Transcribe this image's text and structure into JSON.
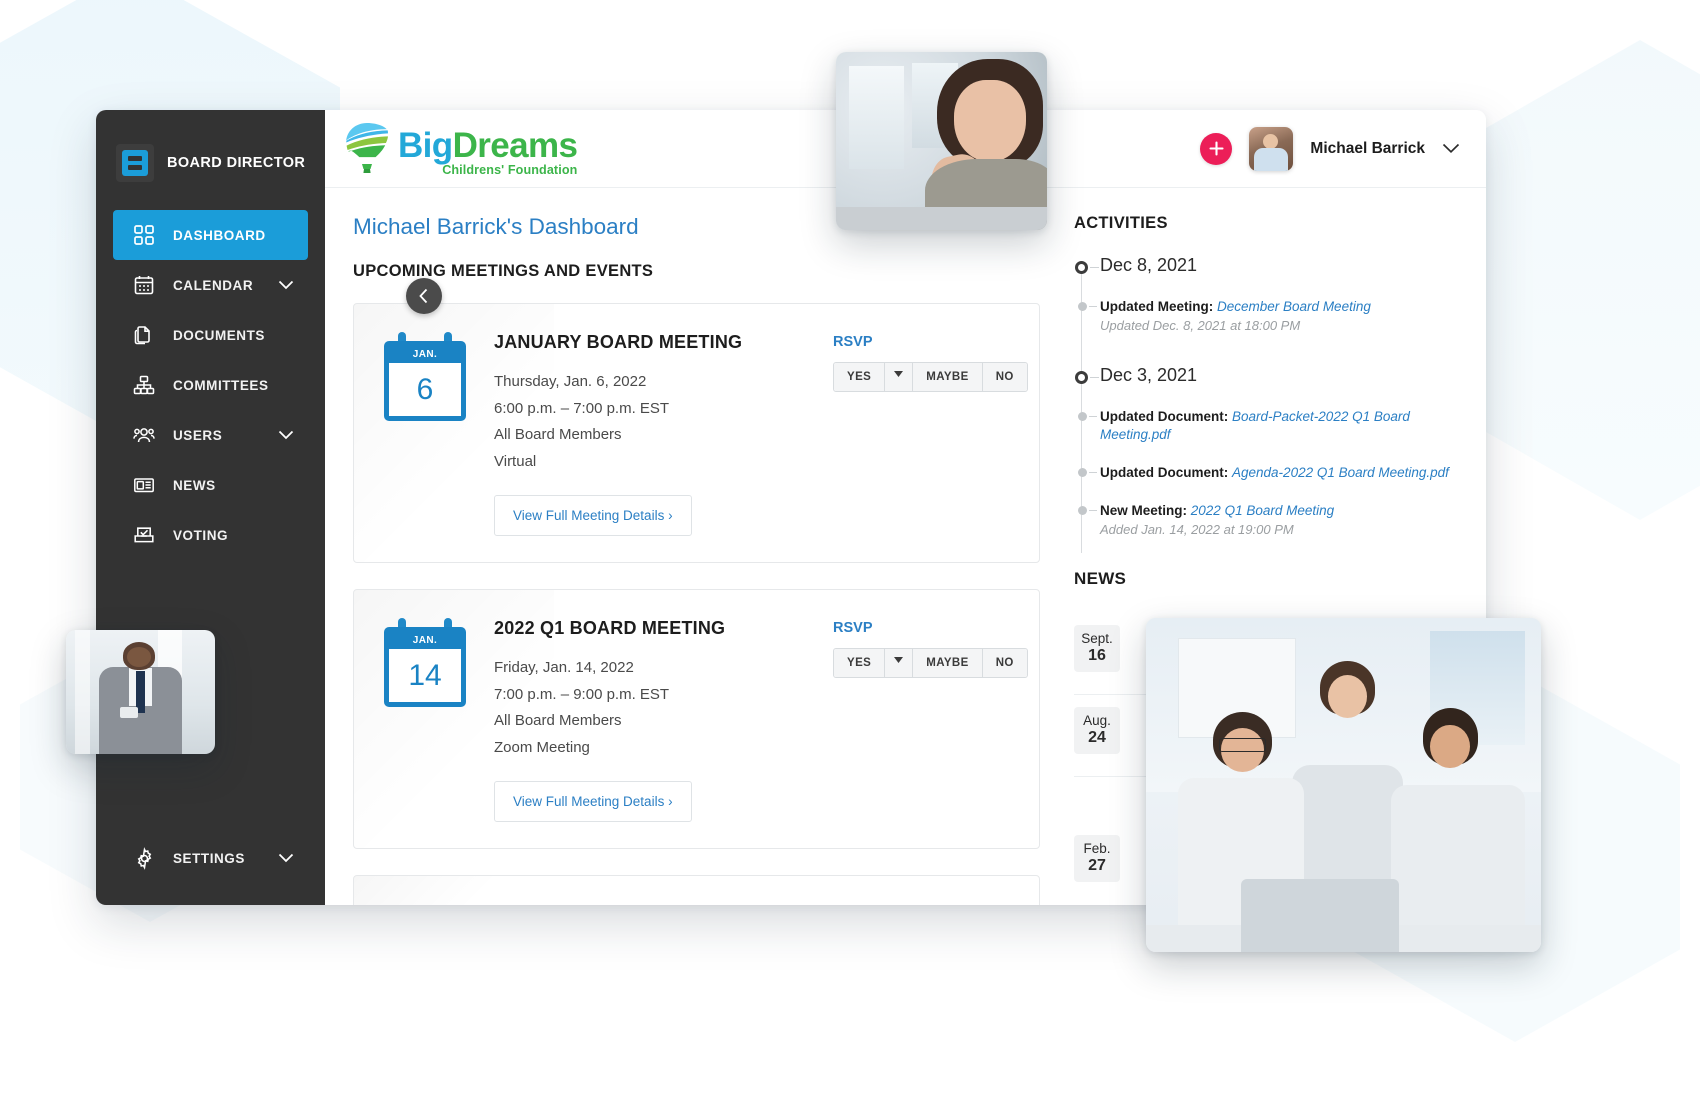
{
  "sidebar": {
    "brand": "BOARD DIRECTOR",
    "brand_icon": "board-director-logo-icon",
    "items": [
      {
        "label": "DASHBOARD",
        "icon": "grid-icon",
        "active": true,
        "chevron": false
      },
      {
        "label": "CALENDAR",
        "icon": "calendar-icon",
        "active": false,
        "chevron": true
      },
      {
        "label": "DOCUMENTS",
        "icon": "documents-icon",
        "active": false,
        "chevron": false
      },
      {
        "label": "COMMITTEES",
        "icon": "org-chart-icon",
        "active": false,
        "chevron": false
      },
      {
        "label": "USERS",
        "icon": "users-icon",
        "active": false,
        "chevron": true
      },
      {
        "label": "NEWS",
        "icon": "newspaper-icon",
        "active": false,
        "chevron": false
      },
      {
        "label": "VOTING",
        "icon": "ballot-box-icon",
        "active": false,
        "chevron": false
      }
    ],
    "settings": {
      "label": "SETTINGS",
      "icon": "gear-icon",
      "chevron": true
    },
    "collapse_icon": "chevron-left-icon"
  },
  "topbar": {
    "logo": {
      "word1": "Big",
      "word2": "Dreams",
      "tagline": "Childrens' Foundation",
      "icon": "hot-air-balloon-icon"
    },
    "add_button_label": "+",
    "user_name": "Michael Barrick",
    "user_caret_icon": "chevron-down-icon"
  },
  "page": {
    "title": "Michael Barrick's Dashboard",
    "meetings_section_title": "UPCOMING MEETINGS AND EVENTS"
  },
  "meetings": [
    {
      "month": "JAN.",
      "day": "6",
      "title": "JANUARY BOARD MEETING",
      "date": "Thursday, Jan. 6, 2022",
      "time": "6:00 p.m. – 7:00 p.m. EST",
      "audience": "All Board Members",
      "location": "Virtual",
      "details_label": "View Full Meeting Details ›",
      "rsvp_label": "RSVP",
      "rsvp_options": [
        "YES",
        "MAYBE",
        "NO"
      ],
      "rsvp_caret_icon": "caret-down-icon"
    },
    {
      "month": "JAN.",
      "day": "14",
      "title": "2022 Q1 BOARD MEETING",
      "date": "Friday, Jan. 14, 2022",
      "time": "7:00 p.m. – 9:00 p.m. EST",
      "audience": "All Board Members",
      "location": "Zoom Meeting",
      "details_label": "View Full Meeting Details ›",
      "rsvp_label": "RSVP",
      "rsvp_options": [
        "YES",
        "MAYBE",
        "NO"
      ],
      "rsvp_caret_icon": "caret-down-icon"
    }
  ],
  "activities": {
    "title": "ACTIVITIES",
    "groups": [
      {
        "date": "Dec 8, 2021",
        "items": [
          {
            "kind": "Updated Meeting:",
            "target": "December Board Meeting",
            "sub": "Updated Dec. 8, 2021 at 18:00 PM"
          }
        ]
      },
      {
        "date": "Dec 3, 2021",
        "items": [
          {
            "kind": "Updated Document:",
            "target": "Board-Packet-2022 Q1 Board Meeting.pdf",
            "sub": ""
          },
          {
            "kind": "Updated Document:",
            "target": "Agenda-2022 Q1 Board Meeting.pdf",
            "sub": ""
          },
          {
            "kind": "New Meeting:",
            "target": "2022 Q1 Board Meeting",
            "sub": "Added Jan. 14, 2022 at 19:00 PM"
          }
        ]
      }
    ]
  },
  "news": {
    "title": "NEWS",
    "items": [
      {
        "month": "Sept.",
        "day": "16"
      },
      {
        "month": "Aug.",
        "day": "24"
      },
      {
        "month": "Feb.",
        "day": "27"
      }
    ]
  },
  "photos": [
    {
      "name": "woman-at-desk-photo"
    },
    {
      "name": "man-with-phone-photo"
    },
    {
      "name": "team-meeting-photo"
    }
  ],
  "colors": {
    "accent_blue": "#1b9dd9",
    "link_blue": "#2b7fc4",
    "sidebar_bg": "#333333",
    "fab_pink": "#ec1e58",
    "logo_blue": "#23a8d8",
    "logo_green": "#3cb54a"
  }
}
